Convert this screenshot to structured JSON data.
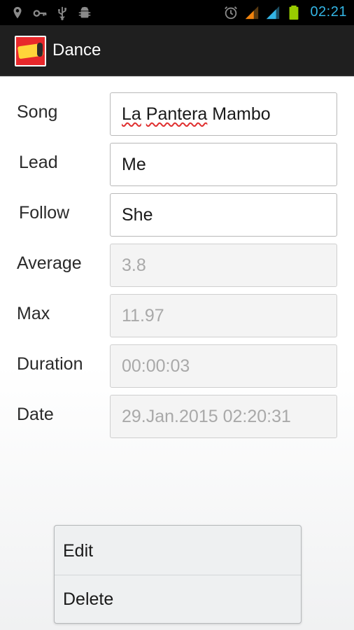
{
  "status_bar": {
    "time": "02:21",
    "left_icons": [
      "gps-icon",
      "key-icon",
      "usb-icon",
      "android-debug-icon"
    ],
    "right_icons": [
      "alarm-icon",
      "cell-signal-orange-icon",
      "cell-signal-blue-icon",
      "battery-icon"
    ],
    "accent": "#33b5e5"
  },
  "action_bar": {
    "title": "Dance",
    "logo": "app-logo"
  },
  "form": {
    "song": {
      "label": "Song",
      "value_words": [
        "La",
        "Pantera",
        "Mambo"
      ]
    },
    "lead": {
      "label": "Lead",
      "value": "Me"
    },
    "follow": {
      "label": "Follow",
      "value": "She"
    },
    "average": {
      "label": "Average",
      "value": "3.8"
    },
    "max": {
      "label": "Max",
      "value": "11.97"
    },
    "duration": {
      "label": "Duration",
      "value": "00:00:03"
    },
    "date": {
      "label": "Date",
      "value": "29.Jan.2015 02:20:31"
    }
  },
  "context_menu": {
    "items": [
      {
        "label": "Edit"
      },
      {
        "label": "Delete"
      }
    ]
  }
}
